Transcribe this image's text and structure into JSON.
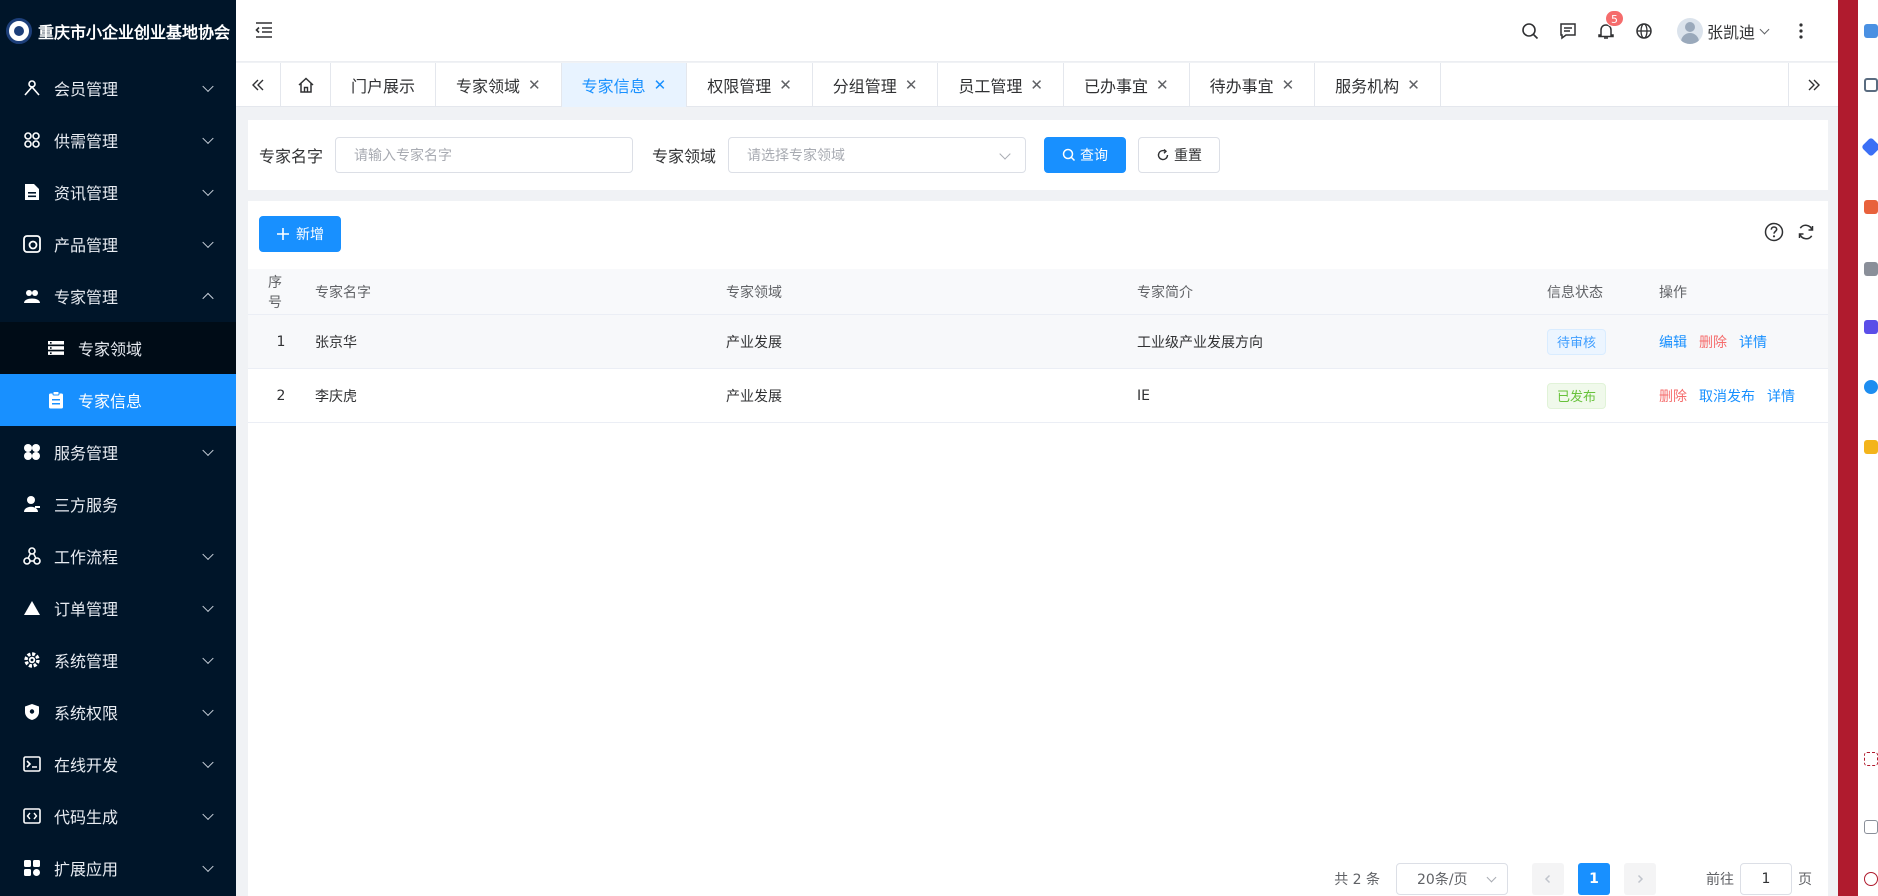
{
  "app": {
    "title": "重庆市小企业创业基地协会"
  },
  "sidebar": {
    "items": [
      {
        "label": "会员管理",
        "icon": "member-icon"
      },
      {
        "label": "供需管理",
        "icon": "supply-icon"
      },
      {
        "label": "资讯管理",
        "icon": "news-icon"
      },
      {
        "label": "产品管理",
        "icon": "product-icon"
      },
      {
        "label": "专家管理",
        "icon": "expert-icon",
        "expanded": true,
        "children": [
          {
            "label": "专家领域",
            "icon": "list-icon"
          },
          {
            "label": "专家信息",
            "icon": "clipboard-icon",
            "active": true
          }
        ]
      },
      {
        "label": "服务管理",
        "icon": "service-icon"
      },
      {
        "label": "三方服务",
        "icon": "third-party-icon"
      },
      {
        "label": "工作流程",
        "icon": "workflow-icon"
      },
      {
        "label": "订单管理",
        "icon": "order-icon"
      },
      {
        "label": "系统管理",
        "icon": "gear-icon"
      },
      {
        "label": "系统权限",
        "icon": "shield-icon"
      },
      {
        "label": "在线开发",
        "icon": "terminal-icon"
      },
      {
        "label": "代码生成",
        "icon": "code-icon"
      },
      {
        "label": "扩展应用",
        "icon": "extension-icon"
      }
    ]
  },
  "header": {
    "notification_count": "5",
    "username": "张凯迪"
  },
  "tabs": [
    {
      "label": "门户展示"
    },
    {
      "label": "专家领域",
      "closable": true
    },
    {
      "label": "专家信息",
      "closable": true,
      "active": true
    },
    {
      "label": "权限管理",
      "closable": true
    },
    {
      "label": "分组管理",
      "closable": true
    },
    {
      "label": "员工管理",
      "closable": true
    },
    {
      "label": "已办事宜",
      "closable": true
    },
    {
      "label": "待办事宜",
      "closable": true
    },
    {
      "label": "服务机构",
      "closable": true
    }
  ],
  "search": {
    "name_label": "专家名字",
    "name_placeholder": "请输入专家名字",
    "field_label": "专家领域",
    "field_placeholder": "请选择专家领域",
    "query_label": "查询",
    "reset_label": "重置"
  },
  "toolbar": {
    "add_label": "新增"
  },
  "table": {
    "columns": [
      "序号",
      "专家名字",
      "专家领域",
      "专家简介",
      "信息状态",
      "操作"
    ],
    "rows": [
      {
        "index": "1",
        "name": "张京华",
        "field": "产业发展",
        "intro": "工业级产业发展方向",
        "status": "待审核",
        "status_type": "pending",
        "actions": [
          {
            "label": "编辑",
            "type": "primary"
          },
          {
            "label": "删除",
            "type": "danger"
          },
          {
            "label": "详情",
            "type": "primary"
          }
        ]
      },
      {
        "index": "2",
        "name": "李庆虎",
        "field": "产业发展",
        "intro": "IE",
        "status": "已发布",
        "status_type": "published",
        "actions": [
          {
            "label": "删除",
            "type": "danger"
          },
          {
            "label": "取消发布",
            "type": "primary"
          },
          {
            "label": "详情",
            "type": "primary"
          }
        ]
      }
    ]
  },
  "pagination": {
    "total_text": "共 2 条",
    "page_size": "20条/页",
    "current_page": "1",
    "goto_prefix": "前往",
    "goto_value": "1",
    "goto_suffix": "页"
  },
  "colors": {
    "sidebar_bg": "#001529",
    "accent": "#1890ff",
    "danger": "#f56c6c",
    "success": "#67c23a"
  }
}
